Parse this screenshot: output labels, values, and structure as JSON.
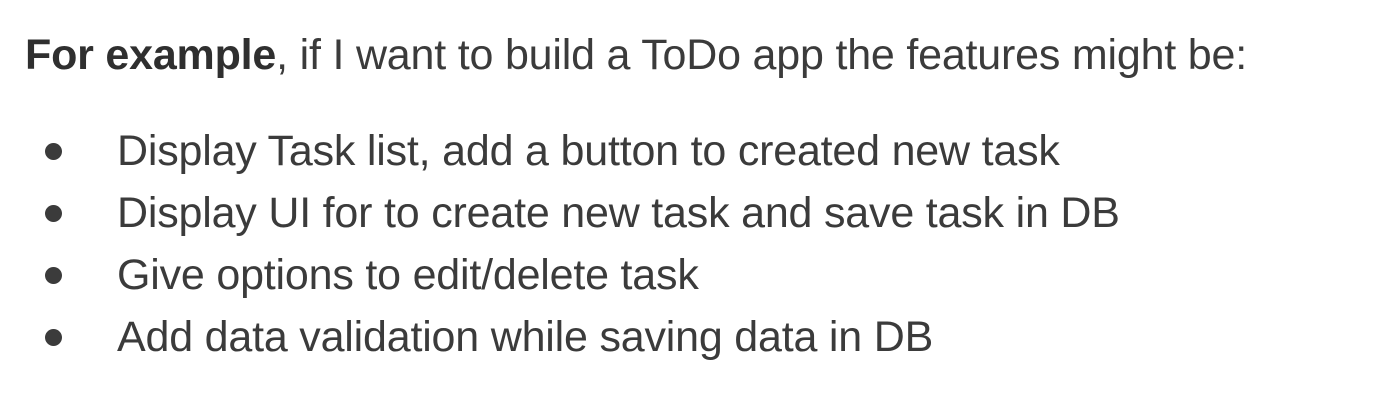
{
  "intro": {
    "lead": "For example",
    "rest": ", if I want to build a ToDo app the features might be:"
  },
  "features": [
    {
      "text": "Display Task list, add a button to created new task"
    },
    {
      "text": "Display UI for to create new task and save task in DB"
    },
    {
      "text": "Give options to edit/delete task"
    },
    {
      "text": "Add data validation while saving data in DB"
    }
  ],
  "colors": {
    "text": "#3b3b3b",
    "background": "#ffffff"
  }
}
